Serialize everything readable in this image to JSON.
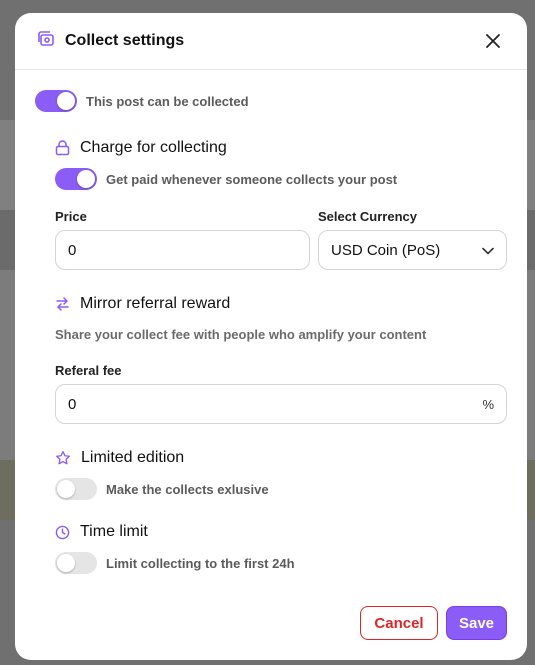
{
  "modal": {
    "title": "Collect settings"
  },
  "collectible": {
    "label": "This post can be collected",
    "enabled": true
  },
  "charge": {
    "title": "Charge for collecting",
    "toggle_label": "Get paid whenever someone collects your post",
    "enabled": true,
    "price_label": "Price",
    "price_value": "0",
    "currency_label": "Select Currency",
    "currency_value": "USD Coin (PoS)"
  },
  "mirror": {
    "title": "Mirror referral reward",
    "helper": "Share your collect fee with people who amplify your content",
    "fee_label": "Referal fee",
    "fee_value": "0",
    "fee_suffix": "%"
  },
  "limited": {
    "title": "Limited edition",
    "toggle_label": "Make the collects exlusive",
    "enabled": false
  },
  "time_limit": {
    "title": "Time limit",
    "toggle_label": "Limit collecting to the first 24h",
    "enabled": false
  },
  "actions": {
    "cancel_label": "Cancel",
    "save_label": "Save"
  },
  "colors": {
    "accent": "#8b5cf6",
    "danger": "#dc2626"
  }
}
